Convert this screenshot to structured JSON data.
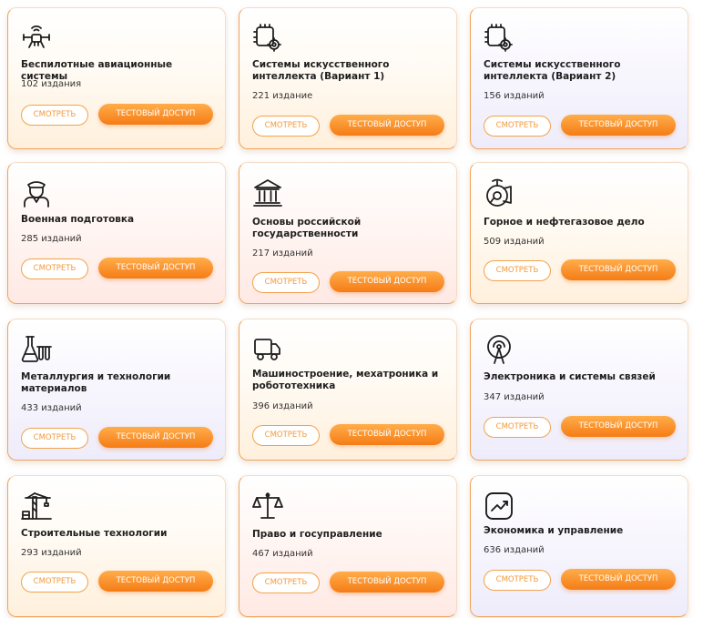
{
  "buttons": {
    "watch": "СМОТРЕТЬ",
    "test_access": "ТЕСТОВЫЙ ДОСТУП"
  },
  "colors": {
    "accent": "#f58a22",
    "button_gradient_top": "#ffad4a",
    "button_gradient_bottom": "#f57c16",
    "border_accent": "#f1a35a"
  },
  "cards": [
    {
      "title": "Беспилотные авиационные системы",
      "count": "102 издания",
      "icon": "drone-icon"
    },
    {
      "title": "Системы искусственного интеллекта (Вариант 1)",
      "count": "221 издание",
      "icon": "ai-chip-gear-icon"
    },
    {
      "title": "Системы искусственного интеллекта (Вариант 2)",
      "count": "156 изданий",
      "icon": "ai-chip-gear-icon"
    },
    {
      "title": "Военная подготовка",
      "count": "285 изданий",
      "icon": "soldier-icon"
    },
    {
      "title": "Основы российской государственности",
      "count": "217 изданий",
      "icon": "government-building-icon"
    },
    {
      "title": "Горное и нефтегазовое дело",
      "count": "509 изданий",
      "icon": "mining-icon"
    },
    {
      "title": "Металлургия и технологии материалов",
      "count": "433 изданий",
      "icon": "flask-tubes-icon"
    },
    {
      "title": "Машиностроение, мехатроника и робототехника",
      "count": "396 изданий",
      "icon": "truck-icon"
    },
    {
      "title": "Электроника и системы связей",
      "count": "347 изданий",
      "icon": "radio-tower-icon"
    },
    {
      "title": "Строительные технологии",
      "count": "293 изданий",
      "icon": "crane-icon"
    },
    {
      "title": "Право и госуправление",
      "count": "467 изданий",
      "icon": "scales-icon"
    },
    {
      "title": "Экономика и управление",
      "count": "636 изданий",
      "icon": "chart-growth-icon"
    }
  ]
}
